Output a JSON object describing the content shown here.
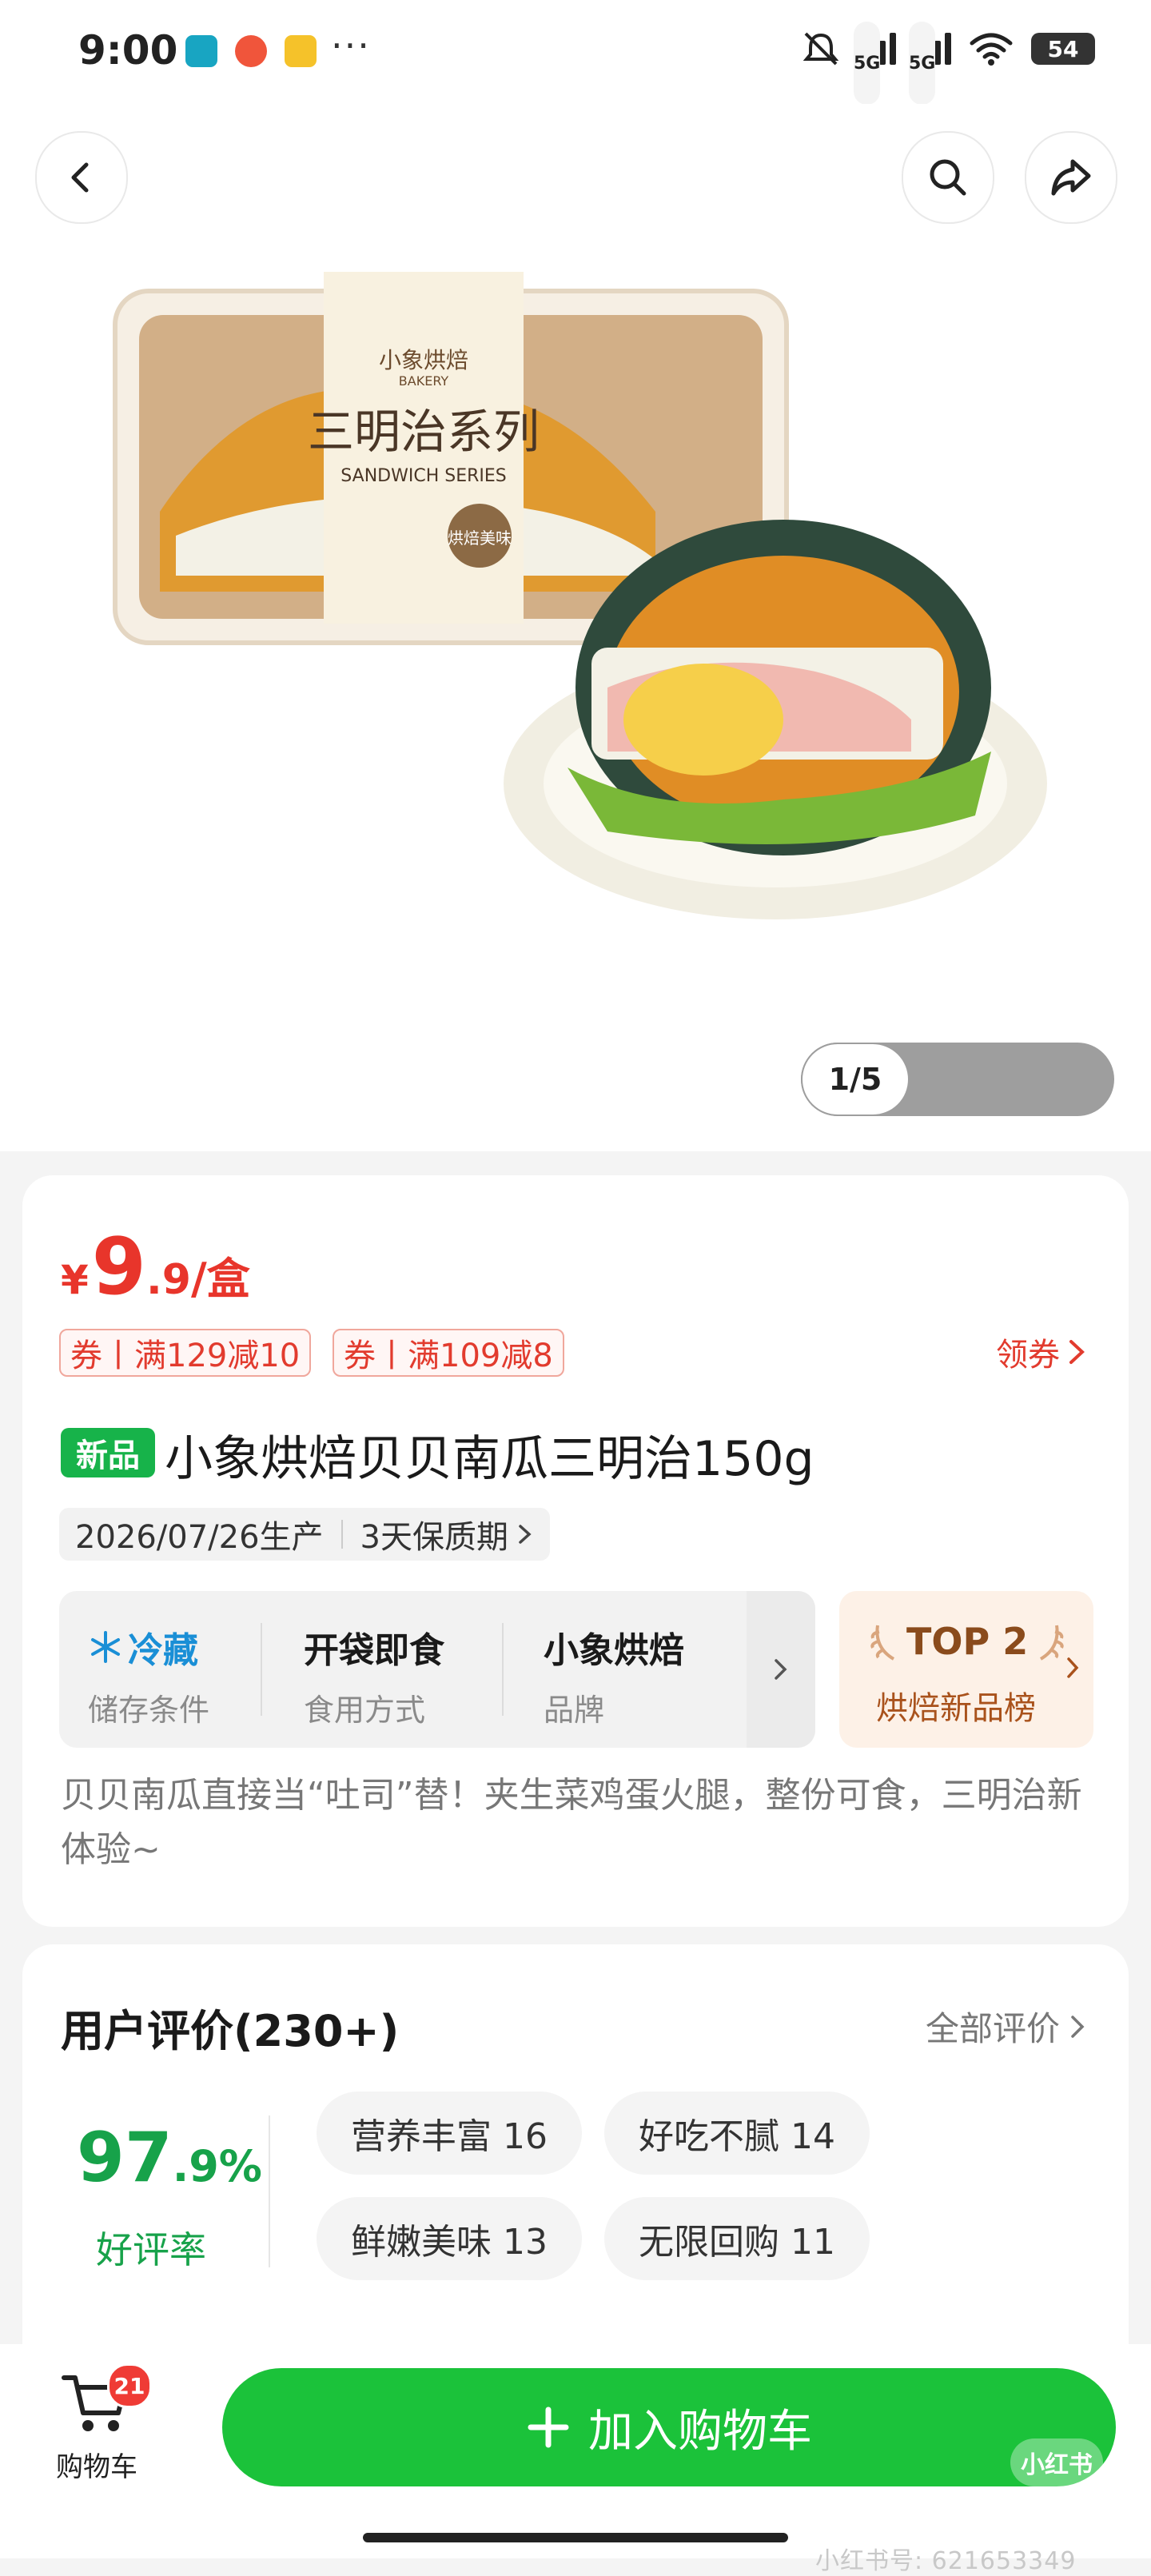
{
  "status": {
    "time": "9:00",
    "net1": "5G",
    "net2": "5G",
    "battery": "54",
    "more": "···"
  },
  "gallery": {
    "counter": "1/5",
    "box_brand": "小象烘焙",
    "box_brand_en": "BAKERY",
    "box_series": "三明治系列",
    "box_series_en": "SANDWICH SERIES",
    "box_stamp": "烘焙美味"
  },
  "product": {
    "price_currency": "¥",
    "price_int": "9",
    "price_dec": ".9",
    "price_unit": "/盒",
    "coupons": [
      "券丨满129减10",
      "券丨满109减8"
    ],
    "get_coupon": "领券",
    "badge": "新品",
    "title": "小象烘焙贝贝南瓜三明治150g",
    "production_date": "2026/07/26生产",
    "shelf_life": "3天保质期",
    "attributes": [
      {
        "value": "冷藏",
        "label": "储存条件"
      },
      {
        "value": "开袋即食",
        "label": "食用方式"
      },
      {
        "value": "小象烘焙",
        "label": "品牌"
      }
    ],
    "top_rank": {
      "title": "TOP 2",
      "subtitle": "烘焙新品榜"
    },
    "description": "贝贝南瓜直接当“吐司”替！夹生菜鸡蛋火腿，整份可食，三明治新体验~"
  },
  "reviews": {
    "title": "用户评价(230+)",
    "all_label": "全部评价",
    "rate_int": "97",
    "rate_dec": ".9%",
    "rate_label": "好评率",
    "tags": [
      "营养丰富 16",
      "好吃不腻 14",
      "鲜嫩美味 13",
      "无限回购 11"
    ]
  },
  "bottom": {
    "cart_label": "购物车",
    "cart_count": "21",
    "add_to_cart": "加入购物车",
    "xhs_logo": "小红书",
    "watermark": "小红书号: 621653349"
  },
  "colors": {
    "price_red": "#e8352b",
    "brand_green": "#1bc23a",
    "badge_green": "#17b34a"
  }
}
